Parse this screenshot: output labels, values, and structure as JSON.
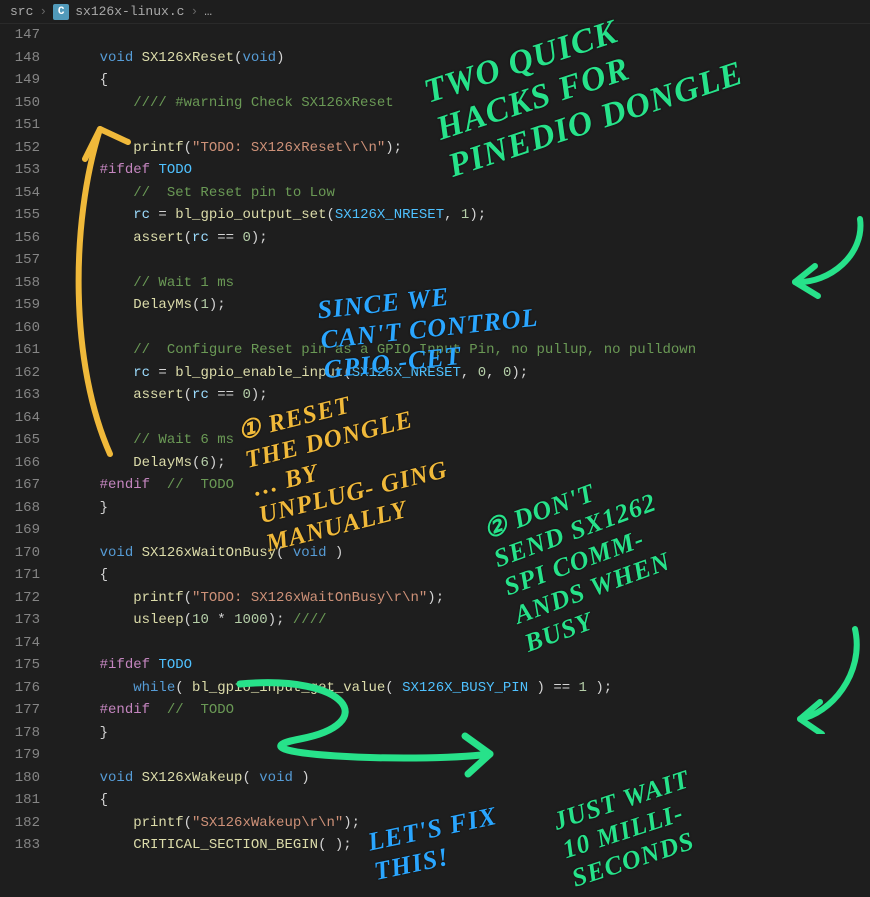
{
  "breadcrumb": {
    "folder": "src",
    "icon": "C",
    "file": "sx126x-linux.c",
    "more": "…"
  },
  "handwriting": {
    "title": "TWO QUICK HACKS FOR PINEDIO DONGLE",
    "since": "SINCE WE CAN'T CONTROL GPIO -CET",
    "reset": "① RESET THE DONGLE … BY UNPLUG- GING MANUALLY",
    "dontsend": "② DON'T SEND SX1262 SPI COMM- ANDS WHEN BUSY",
    "fix": "LET'S FIX THIS!",
    "wait": "JUST WAIT 10 MILLI- SECONDS"
  },
  "colors": {
    "green": "#27e28a",
    "blue": "#2aa6ff",
    "yellow": "#f0b93a",
    "bg": "#1e1e1e"
  },
  "line_start": 147,
  "lines": [
    {
      "n": 147,
      "html": ""
    },
    {
      "n": 148,
      "html": "    <span class='kw'>void</span> <span class='fn'>SX126xReset</span>(<span class='kw'>void</span>)"
    },
    {
      "n": 149,
      "html": "    {"
    },
    {
      "n": 150,
      "html": "        <span class='cm'>//// #warning Check SX126xReset</span>"
    },
    {
      "n": 151,
      "html": ""
    },
    {
      "n": 152,
      "html": "        <span class='fn'>printf</span>(<span class='str'>\"TODO: SX126xReset\\r\\n\"</span>);"
    },
    {
      "n": 153,
      "html": "    <span class='pp'>#ifdef</span> <span class='const'>TODO</span>"
    },
    {
      "n": 154,
      "html": "        <span class='cm'>//  Set Reset pin to Low</span>"
    },
    {
      "n": 155,
      "html": "        <span class='id'>rc</span> = <span class='fn'>bl_gpio_output_set</span>(<span class='const'>SX126X_NRESET</span>, <span class='num'>1</span>);"
    },
    {
      "n": 156,
      "html": "        <span class='fn'>assert</span>(<span class='id'>rc</span> == <span class='num'>0</span>);"
    },
    {
      "n": 157,
      "html": ""
    },
    {
      "n": 158,
      "html": "        <span class='cm'>// Wait 1 ms</span>"
    },
    {
      "n": 159,
      "html": "        <span class='fn'>DelayMs</span>(<span class='num'>1</span>);"
    },
    {
      "n": 160,
      "html": ""
    },
    {
      "n": 161,
      "html": "        <span class='cm'>//  Configure Reset pin as a GPIO Input Pin, no pullup, no pulldown</span>"
    },
    {
      "n": 162,
      "html": "        <span class='id'>rc</span> = <span class='fn'>bl_gpio_enable_input</span>(<span class='const'>SX126X_NRESET</span>, <span class='num'>0</span>, <span class='num'>0</span>);"
    },
    {
      "n": 163,
      "html": "        <span class='fn'>assert</span>(<span class='id'>rc</span> == <span class='num'>0</span>);"
    },
    {
      "n": 164,
      "html": ""
    },
    {
      "n": 165,
      "html": "        <span class='cm'>// Wait 6 ms</span>"
    },
    {
      "n": 166,
      "html": "        <span class='fn'>DelayMs</span>(<span class='num'>6</span>);"
    },
    {
      "n": 167,
      "html": "    <span class='pp'>#endif</span>  <span class='cm'>//  TODO</span>"
    },
    {
      "n": 168,
      "html": "    }"
    },
    {
      "n": 169,
      "html": ""
    },
    {
      "n": 170,
      "html": "    <span class='kw'>void</span> <span class='fn'>SX126xWaitOnBusy</span>( <span class='kw'>void</span> )"
    },
    {
      "n": 171,
      "html": "    {"
    },
    {
      "n": 172,
      "html": "        <span class='fn'>printf</span>(<span class='str'>\"TODO: SX126xWaitOnBusy\\r\\n\"</span>);"
    },
    {
      "n": 173,
      "html": "        <span class='fn'>usleep</span>(<span class='num'>10</span> * <span class='num'>1000</span>); <span class='cm'>////</span>"
    },
    {
      "n": 174,
      "html": ""
    },
    {
      "n": 175,
      "html": "    <span class='pp'>#ifdef</span> <span class='const'>TODO</span>"
    },
    {
      "n": 176,
      "html": "        <span class='kw'>while</span>( <span class='fn'>bl_gpio_input_get_value</span>( <span class='const'>SX126X_BUSY_PIN</span> ) == <span class='num'>1</span> );"
    },
    {
      "n": 177,
      "html": "    <span class='pp'>#endif</span>  <span class='cm'>//  TODO</span>"
    },
    {
      "n": 178,
      "html": "    }"
    },
    {
      "n": 179,
      "html": ""
    },
    {
      "n": 180,
      "html": "    <span class='kw'>void</span> <span class='fn'>SX126xWakeup</span>( <span class='kw'>void</span> )"
    },
    {
      "n": 181,
      "html": "    {"
    },
    {
      "n": 182,
      "html": "        <span class='fn'>printf</span>(<span class='str'>\"SX126xWakeup\\r\\n\"</span>);"
    },
    {
      "n": 183,
      "html": "        <span class='fn'>CRITICAL_SECTION_BEGIN</span>( );"
    }
  ]
}
